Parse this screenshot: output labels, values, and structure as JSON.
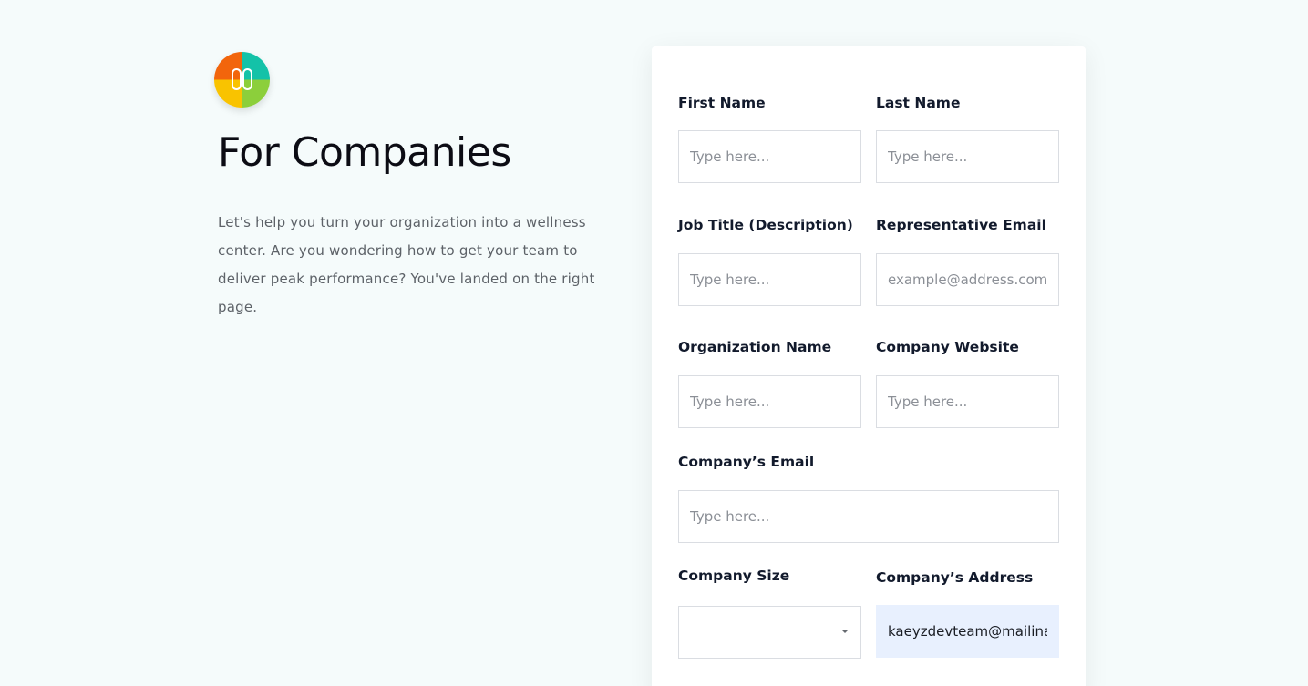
{
  "brand": {
    "logo_icon": "wellness-logo-icon",
    "colors": [
      "#f2650c",
      "#14c2a8",
      "#f9c300",
      "#8ccf3b"
    ]
  },
  "hero": {
    "title": "For Companies",
    "description": "Let's help you turn your organization into a wellness center. Are you wondering how to get your team to deliver peak performance? You've landed on the right page."
  },
  "form": {
    "first_name": {
      "label": "First Name",
      "placeholder": "Type here...",
      "value": ""
    },
    "last_name": {
      "label": "Last Name",
      "placeholder": "Type here...",
      "value": ""
    },
    "job_title": {
      "label": "Job Title (Description)",
      "placeholder": "Type here...",
      "value": ""
    },
    "rep_email": {
      "label": "Representative Email",
      "placeholder": "example@address.com",
      "value": ""
    },
    "org_name": {
      "label": "Organization Name",
      "placeholder": "Type here...",
      "value": ""
    },
    "company_website": {
      "label": "Company Website",
      "placeholder": "Type here...",
      "value": ""
    },
    "company_email": {
      "label": "Company’s Email",
      "placeholder": "Type here...",
      "value": ""
    },
    "company_size": {
      "label": "Company Size",
      "selected": ""
    },
    "company_address": {
      "label": "Company’s Address",
      "value": "kaeyzdevteam@mailinator.com"
    }
  }
}
